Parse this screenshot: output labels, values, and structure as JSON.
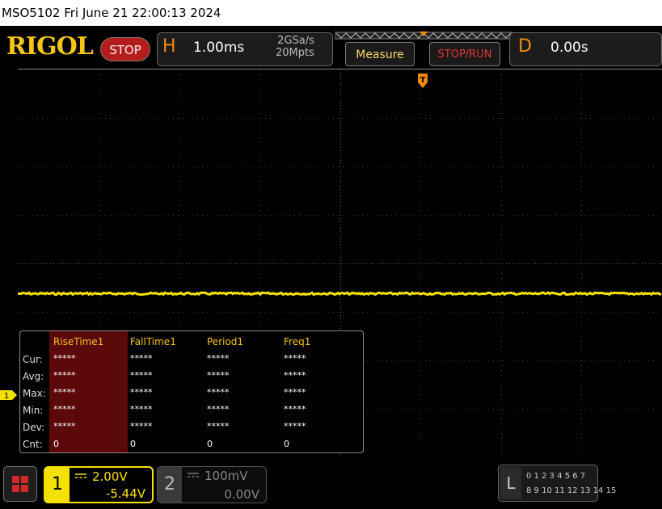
{
  "titlebar": {
    "text": "MSO5102  Fri June 21 22:00:13 2024"
  },
  "topbar": {
    "logo": "RIGOL",
    "run_state": "STOP",
    "horizontal": {
      "letter": "H",
      "timebase": "1.00ms",
      "sample_rate": "2GSa/s",
      "memory_depth": "20Mpts"
    },
    "measure_label": "Measure",
    "stop_run_label": "STOP/RUN",
    "delay": {
      "letter": "D",
      "value": "0.00s"
    }
  },
  "trace": {
    "level": 0.578,
    "color": "#f5e100"
  },
  "measurements": {
    "headers": [
      "RiseTime1",
      "FallTime1",
      "Period1",
      "Freq1"
    ],
    "rows": [
      {
        "label": "Cur:",
        "values": [
          "*****",
          "*****",
          "*****",
          "*****"
        ]
      },
      {
        "label": "Avg:",
        "values": [
          "*****",
          "*****",
          "*****",
          "*****"
        ]
      },
      {
        "label": "Max:",
        "values": [
          "*****",
          "*****",
          "*****",
          "*****"
        ]
      },
      {
        "label": "Min:",
        "values": [
          "*****",
          "*****",
          "*****",
          "*****"
        ]
      },
      {
        "label": "Dev:",
        "values": [
          "*****",
          "*****",
          "*****",
          "*****"
        ]
      },
      {
        "label": "Cnt:",
        "values": [
          "0",
          "0",
          "0",
          "0"
        ]
      }
    ]
  },
  "ch1_marker_label": "1",
  "channels": [
    {
      "number": "1",
      "scale": "2.00V",
      "offset": "-5.44V",
      "color": "#f5e100"
    },
    {
      "number": "2",
      "scale": "100mV",
      "offset": "0.00V",
      "color": "#777777"
    }
  ],
  "logic": {
    "letter": "L",
    "row1": "0 1 2 3   4 5 6 7",
    "row2": "8 9 10 11 12 13 14 15"
  },
  "colors": {
    "accent_orange": "#f08a12",
    "logo_yellow": "#f5c518",
    "stop_red": "#b51d1d",
    "measure_highlight": "#5a0808"
  }
}
